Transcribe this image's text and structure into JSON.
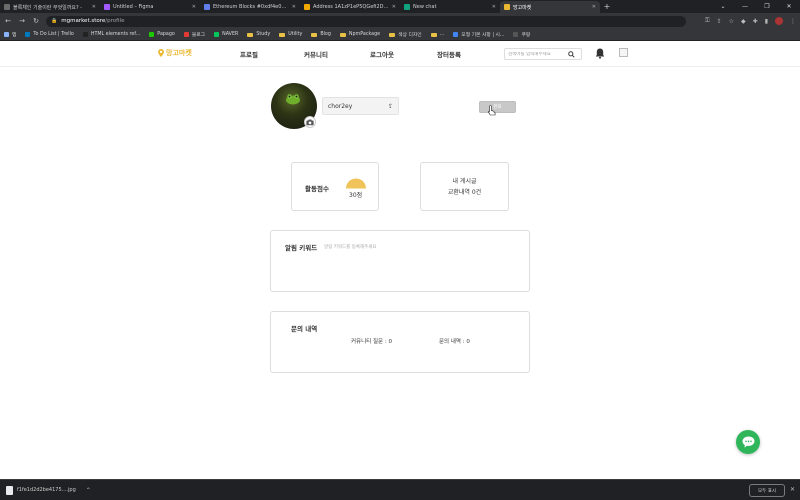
{
  "browser": {
    "tabs": [
      {
        "title": "블록체인 기술이란 무엇일까요? -",
        "color": "#6b6b6b"
      },
      {
        "title": "Untitled – Figma",
        "color": "#a259ff"
      },
      {
        "title": "Ethereum Blocks #0xdf4e0674051",
        "color": "#627eea"
      },
      {
        "title": "Address 1A1zP1eP5QGefi2DMPT",
        "color": "#f2a900"
      },
      {
        "title": "New chat",
        "color": "#10a37f"
      },
      {
        "title": "망고마켓",
        "color": "#e9b730"
      }
    ],
    "active_tab": 5,
    "url_host": "mgmarket.store",
    "url_path": "/profile",
    "bookmarks": [
      {
        "label": "앱",
        "type": "apps"
      },
      {
        "label": "To Do List | Trello",
        "type": "site",
        "color": "#0079bf"
      },
      {
        "label": "HTML elements ref...",
        "type": "site",
        "color": "#222222"
      },
      {
        "label": "Papago",
        "type": "site",
        "color": "#1ec800"
      },
      {
        "label": "블로그",
        "type": "site",
        "color": "#e53935"
      },
      {
        "label": "NAVER",
        "type": "site",
        "color": "#03c75a"
      },
      {
        "label": "Study",
        "type": "folder"
      },
      {
        "label": "Utility",
        "type": "folder"
      },
      {
        "label": "Blog",
        "type": "folder"
      },
      {
        "label": "NpmPackage",
        "type": "folder"
      },
      {
        "label": "색상 디자인",
        "type": "folder"
      },
      {
        "label": "...",
        "type": "folder"
      },
      {
        "label": "모형 기본 사항 | 시...",
        "type": "site",
        "color": "#4285f4"
      },
      {
        "label": "쿠팡",
        "type": "site",
        "color": "#555555"
      }
    ]
  },
  "site": {
    "logo_text": "망고마켓",
    "nav": [
      "프로필",
      "커뮤니티",
      "로그아웃",
      "장터등록"
    ],
    "search_placeholder": "검색어를 입력해주세요",
    "brand_color": "#e9b730"
  },
  "profile": {
    "nickname": "chor2ey",
    "edit_button": "완료",
    "score_label": "활동점수",
    "score_value": "30점",
    "posts_line1": "내 게시글",
    "posts_line2": "교환내역 0건",
    "keyword_title": "알림 키워드",
    "keyword_hint": "알림 키워드를 등록해주세요",
    "inquiry_title": "문의 내역",
    "community_question": "커뮤니티 질문 : 0",
    "inquiry_count": "문의 내역 : 0"
  },
  "download": {
    "filename": "f1fe1d2d2be4175....jpg",
    "show_all": "모두 표시"
  }
}
